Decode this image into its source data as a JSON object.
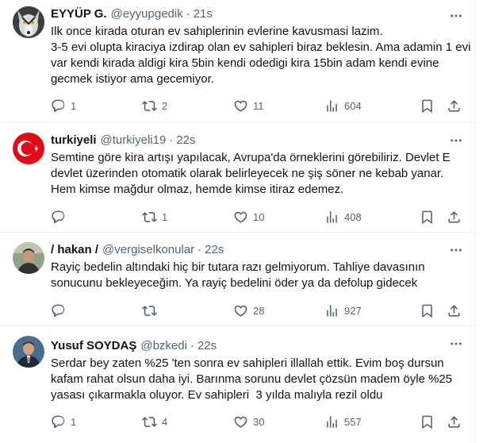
{
  "tweets": [
    {
      "name": "EYYÜP G.",
      "handle": "@eyyupgedik",
      "time": "21s",
      "text": "Ilk once kirada oturan ev sahiplerinin evlerine kavusmasi lazim.\n3-5 evi olupta kiraciya izdirap olan ev sahipleri biraz beklesin. Ama adamin 1 evi var kendi kirada aldigi kira 5bin kendi odedigi kira 15bin adam kendi evine gecmek istiyor ama gecemiyor.",
      "replies": "1",
      "retweets": "2",
      "likes": "11",
      "views": "604",
      "avatar": "wolf-avatar"
    },
    {
      "name": "turkiyeli",
      "handle": "@turkiyeli19",
      "time": "22s",
      "text": "Semtine göre kira artışı yapılacak, Avrupa'da örneklerini görebiliriz. Devlet E devlet üzerinden otomatik olarak belirleyecek ne şiş söner ne kebab yanar. Hem kimse mağdur olmaz, hemde kimse itiraz edemez.",
      "replies": "",
      "retweets": "1",
      "likes": "10",
      "views": "408",
      "avatar": "turkish-flag-avatar"
    },
    {
      "name": "/ hakan /",
      "handle": "@vergiselkonular",
      "time": "22s",
      "text": "Rayiç bedelin altındaki hiç bir tutara razı gelmiyorum. Tahliye davasının sonucunu bekleyeceğim. Ya rayiç bedelini öder ya da defolup gidecek",
      "replies": "",
      "retweets": "",
      "likes": "28",
      "views": "927",
      "avatar": "person-avatar"
    },
    {
      "name": "Yusuf SOYDAŞ",
      "handle": "@bzkedi",
      "time": "22s",
      "text": "Serdar bey zaten %25 'ten sonra ev sahipleri illallah ettik. Evim boş dursun kafam rahat olsun daha iyi. Barınma sorunu devlet çözsün madem öyle %25 yasası çıkarmakla oluyor. Ev sahipleri  3 yılda malıyla rezil oldu",
      "replies": "1",
      "retweets": "4",
      "likes": "30",
      "views": "557",
      "avatar": "person-suit-avatar"
    }
  ]
}
